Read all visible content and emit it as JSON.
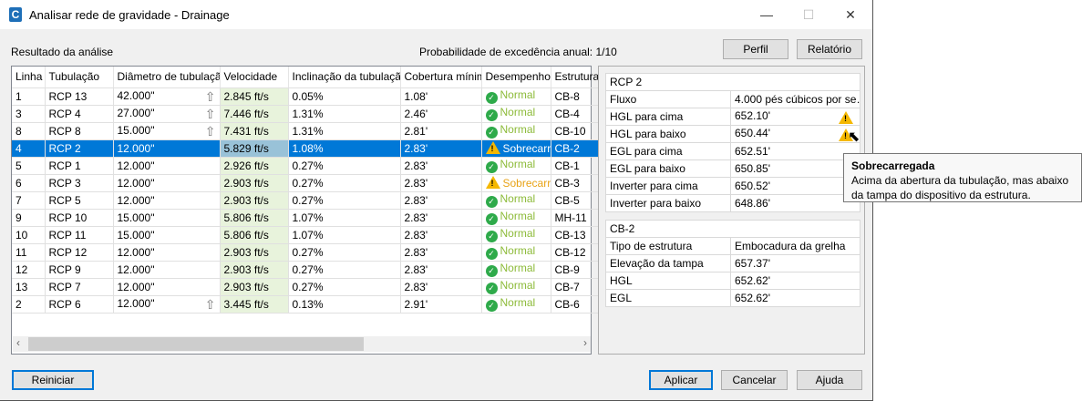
{
  "window": {
    "title": "Analisar rede de gravidade - Drainage",
    "app_icon": "C",
    "minimize": "—",
    "maximize": "☐",
    "close": "✕"
  },
  "header": {
    "results_label": "Resultado da análise",
    "probability_label": "Probabilidade de excedência anual:",
    "probability_value": "1/10",
    "profile_button": "Perfil",
    "report_button": "Relatório"
  },
  "table": {
    "columns": [
      "Linha",
      "Tubulação",
      "Diâmetro de tubulação",
      "Velocidade",
      "Inclinação da tubulação",
      "Cobertura mínima",
      "Desempenho",
      "Estrutura"
    ],
    "rows": [
      {
        "line": "1",
        "pipe": "RCP 13",
        "diameter": "42.000\"",
        "arrow": true,
        "velocity": "2.845 ft/s",
        "slope": "0.05%",
        "cover": "1.08'",
        "status": "Normal",
        "structure": "CB-8"
      },
      {
        "line": "3",
        "pipe": "RCP 4",
        "diameter": "27.000\"",
        "arrow": true,
        "velocity": "7.446 ft/s",
        "slope": "1.31%",
        "cover": "2.46'",
        "status": "Normal",
        "structure": "CB-4"
      },
      {
        "line": "8",
        "pipe": "RCP 8",
        "diameter": "15.000\"",
        "arrow": true,
        "velocity": "7.431 ft/s",
        "slope": "1.31%",
        "cover": "2.81'",
        "status": "Normal",
        "structure": "CB-10"
      },
      {
        "line": "4",
        "pipe": "RCP 2",
        "diameter": "12.000\"",
        "arrow": false,
        "velocity": "5.829 ft/s",
        "slope": "1.08%",
        "cover": "2.83'",
        "status": "Sobrecarr",
        "structure": "CB-2",
        "selected": true
      },
      {
        "line": "5",
        "pipe": "RCP 1",
        "diameter": "12.000\"",
        "arrow": false,
        "velocity": "2.926 ft/s",
        "slope": "0.27%",
        "cover": "2.83'",
        "status": "Normal",
        "structure": "CB-1"
      },
      {
        "line": "6",
        "pipe": "RCP 3",
        "diameter": "12.000\"",
        "arrow": false,
        "velocity": "2.903 ft/s",
        "slope": "0.27%",
        "cover": "2.83'",
        "status": "Sobrecarr",
        "structure": "CB-3"
      },
      {
        "line": "7",
        "pipe": "RCP 5",
        "diameter": "12.000\"",
        "arrow": false,
        "velocity": "2.903 ft/s",
        "slope": "0.27%",
        "cover": "2.83'",
        "status": "Normal",
        "structure": "CB-5"
      },
      {
        "line": "9",
        "pipe": "RCP 10",
        "diameter": "15.000\"",
        "arrow": false,
        "velocity": "5.806 ft/s",
        "slope": "1.07%",
        "cover": "2.83'",
        "status": "Normal",
        "structure": "MH-11"
      },
      {
        "line": "10",
        "pipe": "RCP 11",
        "diameter": "15.000\"",
        "arrow": false,
        "velocity": "5.806 ft/s",
        "slope": "1.07%",
        "cover": "2.83'",
        "status": "Normal",
        "structure": "CB-13"
      },
      {
        "line": "11",
        "pipe": "RCP 12",
        "diameter": "12.000\"",
        "arrow": false,
        "velocity": "2.903 ft/s",
        "slope": "0.27%",
        "cover": "2.83'",
        "status": "Normal",
        "structure": "CB-12"
      },
      {
        "line": "12",
        "pipe": "RCP 9",
        "diameter": "12.000\"",
        "arrow": false,
        "velocity": "2.903 ft/s",
        "slope": "0.27%",
        "cover": "2.83'",
        "status": "Normal",
        "structure": "CB-9"
      },
      {
        "line": "13",
        "pipe": "RCP 7",
        "diameter": "12.000\"",
        "arrow": false,
        "velocity": "2.903 ft/s",
        "slope": "0.27%",
        "cover": "2.83'",
        "status": "Normal",
        "structure": "CB-7"
      },
      {
        "line": "2",
        "pipe": "RCP 6",
        "diameter": "12.000\"",
        "arrow": true,
        "velocity": "3.445 ft/s",
        "slope": "0.13%",
        "cover": "2.91'",
        "status": "Normal",
        "structure": "CB-6"
      }
    ]
  },
  "pipe_props": {
    "title": "RCP 2",
    "rows": [
      {
        "label": "Fluxo",
        "value": "4.000 pés cúbicos por se…",
        "warn": false
      },
      {
        "label": "HGL para cima",
        "value": "652.10'",
        "warn": true
      },
      {
        "label": "HGL para baixo",
        "value": "650.44'",
        "warn": true
      },
      {
        "label": "EGL para cima",
        "value": "652.51'",
        "warn": false
      },
      {
        "label": "EGL para baixo",
        "value": "650.85'",
        "warn": false
      },
      {
        "label": "Inverter para cima",
        "value": "650.52'",
        "warn": false
      },
      {
        "label": "Inverter para baixo",
        "value": "648.86'",
        "warn": false
      }
    ]
  },
  "structure_props": {
    "title": "CB-2",
    "rows": [
      {
        "label": "Tipo de estrutura",
        "value": "Embocadura da grelha"
      },
      {
        "label": "Elevação da tampa",
        "value": "657.37'"
      },
      {
        "label": "HGL",
        "value": "652.62'"
      },
      {
        "label": "EGL",
        "value": "652.62'"
      }
    ]
  },
  "tooltip": {
    "title": "Sobrecarregada",
    "text": "Acima da abertura da tubulação, mas abaixo da tampa do dispositivo da estrutura."
  },
  "footer": {
    "reset": "Reiniciar",
    "apply": "Aplicar",
    "cancel": "Cancelar",
    "help": "Ajuda"
  },
  "colors": {
    "accent": "#0078d7",
    "normal": "#8dbb3a",
    "warning": "#f5b800",
    "velocity_bg": "#e8f3dc"
  }
}
